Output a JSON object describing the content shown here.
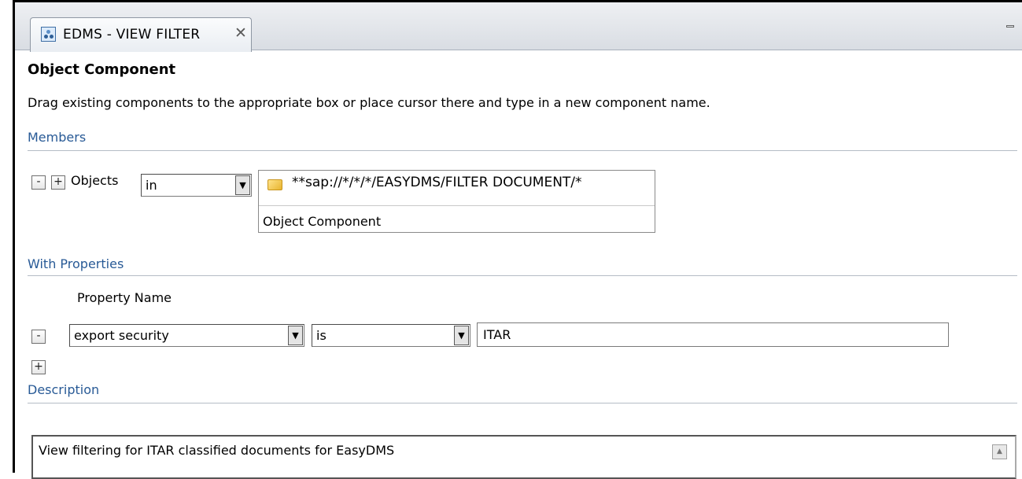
{
  "tab": {
    "title": "EDMS - VIEW FILTER",
    "close_glyph": "✕",
    "icon": "view-filter-icon"
  },
  "window_controls": {
    "minimize": "minimize-icon",
    "maximize": "maximize-icon"
  },
  "header": {
    "title": "Object Component",
    "instructions": "Drag existing components to the appropriate box or place cursor there and type in a new component name."
  },
  "members": {
    "section_label": "Members",
    "remove_button": "-",
    "add_button": "+",
    "objects_label": "Objects",
    "operator": "in",
    "component_path": "**sap://*/*/*/EASYDMS/FILTER DOCUMENT/*",
    "component_type": "Object Component"
  },
  "properties": {
    "section_label": "With Properties",
    "column_header": "Property Name",
    "remove_button": "-",
    "add_button": "+",
    "rows": [
      {
        "property": "export security",
        "operator": "is",
        "value": "ITAR"
      }
    ]
  },
  "description": {
    "section_label": "Description",
    "text": "View filtering for ITAR classified documents for EasyDMS"
  },
  "colors": {
    "section_title": "#285a96",
    "rule": "#b5bcc5"
  }
}
